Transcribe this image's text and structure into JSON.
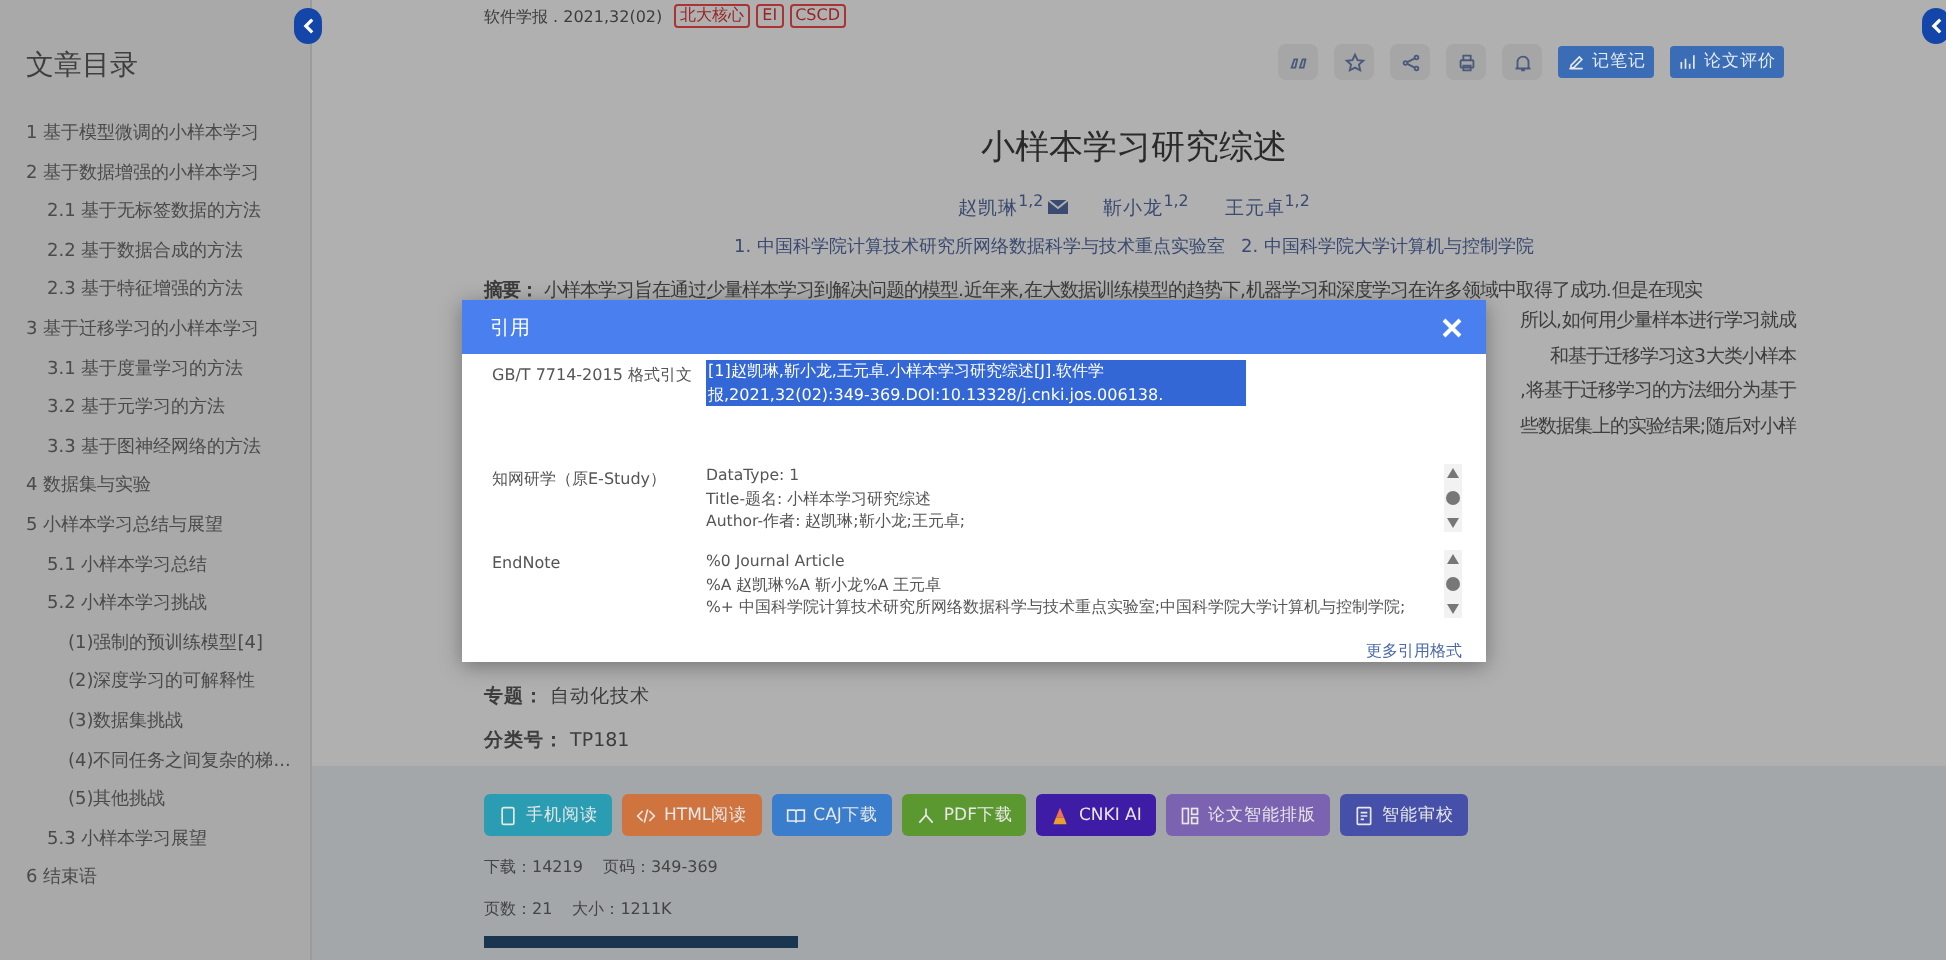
{
  "sidebar": {
    "title": "文章目录",
    "toc": [
      {
        "label": "1 基于模型微调的小样本学习"
      },
      {
        "label": "2 基于数据增强的小样本学习",
        "children": [
          {
            "label": "2.1 基于无标签数据的方法"
          },
          {
            "label": "2.2 基于数据合成的方法"
          },
          {
            "label": "2.3 基于特征增强的方法"
          }
        ]
      },
      {
        "label": "3 基于迁移学习的小样本学习",
        "children": [
          {
            "label": "3.1 基于度量学习的方法"
          },
          {
            "label": "3.2 基于元学习的方法"
          },
          {
            "label": "3.3 基于图神经网络的方法"
          }
        ]
      },
      {
        "label": "4 数据集与实验"
      },
      {
        "label": "5 小样本学习总结与展望",
        "children": [
          {
            "label": "5.1 小样本学习总结"
          },
          {
            "label": "5.2 小样本学习挑战",
            "children": [
              {
                "label": "(1)强制的预训练模型[4]"
              },
              {
                "label": "(2)深度学习的可解释性"
              },
              {
                "label": "(3)数据集挑战"
              },
              {
                "label": "(4)不同任务之间复杂的梯..."
              },
              {
                "label": "(5)其他挑战"
              }
            ]
          },
          {
            "label": "5.3 小样本学习展望"
          }
        ]
      },
      {
        "label": "6 结束语"
      }
    ]
  },
  "meta": {
    "source": "软件学报 . 2021,32(02)",
    "tags": [
      "北大核心",
      "EI",
      "CSCD"
    ]
  },
  "toolbar": {
    "buttons": [
      {
        "label": "记笔记"
      },
      {
        "label": "论文评价"
      }
    ]
  },
  "article": {
    "title": "小样本学习研究综述",
    "authors": [
      {
        "name": "赵凯琳",
        "sup": "1,2",
        "mail": true
      },
      {
        "name": "靳小龙",
        "sup": "1,2",
        "mail": false
      },
      {
        "name": "王元卓",
        "sup": "1,2",
        "mail": false
      }
    ],
    "affiliations": [
      "1. 中国科学院计算技术研究所网络数据科学与技术重点实验室",
      "2. 中国科学院大学计算机与控制学院"
    ],
    "abstract_label": "摘要：",
    "abstract_first_line": "小样本学习旨在通过少量样本学习到解决问题的模型.近年来,在大数据训练模型的趋势下,机器学习和深度学习在许多领域中取得了成功.但是在现实",
    "abstract_visible_ends": [
      "所以,如何用少量样本进行学习就成",
      "和基于迁移学习这3大类小样本",
      ",将基于迁移学习的方法细分为基于",
      "些数据集上的实验结果;随后对小样"
    ],
    "fields": [
      {
        "label": "专题：",
        "value": "自动化技术"
      },
      {
        "label": "分类号：",
        "value": "TP181"
      }
    ]
  },
  "actions": [
    {
      "label": "手机阅读",
      "color": "#2a9db3"
    },
    {
      "label": "HTML阅读",
      "color": "#cf733f"
    },
    {
      "label": "CAJ下载",
      "color": "#3a7dcc"
    },
    {
      "label": "PDF下载",
      "color": "#5b982f"
    },
    {
      "label": "CNKI AI",
      "color": "#3e1ca6"
    },
    {
      "label": "论文智能排版",
      "color": "#7b63b2"
    },
    {
      "label": "智能审校",
      "color": "#4750a8"
    }
  ],
  "stats": [
    [
      {
        "label": "下载：",
        "value": "14219"
      },
      {
        "label": "页码：",
        "value": "349-369"
      }
    ],
    [
      {
        "label": "页数：",
        "value": "21"
      },
      {
        "label": "大小：",
        "value": "1211K"
      }
    ]
  ],
  "dialog": {
    "title": "引用",
    "rows": [
      {
        "kind": "selected",
        "label": "GB/T 7714-2015 格式引文",
        "text": "[1]赵凯琳,靳小龙,王元卓.小样本学习研究综述[J].软件学报,2021,32(02):349-369.DOI:10.13328/j.cnki.jos.006138."
      },
      {
        "kind": "scroll",
        "label": "知网研学（原E-Study）",
        "lines": [
          "DataType: 1",
          "Title-题名: 小样本学习研究综述",
          "Author-作者: 赵凯琳;靳小龙;王元卓;"
        ]
      },
      {
        "kind": "scroll",
        "label": "EndNote",
        "lines": [
          "%0 Journal Article",
          "%A 赵凯琳%A 靳小龙%A 王元卓",
          "%+ 中国科学院计算技术研究所网络数据科学与技术重点实验室;中国科学院大学计算机与控制学院;"
        ]
      }
    ],
    "more_link": "更多引用格式"
  }
}
